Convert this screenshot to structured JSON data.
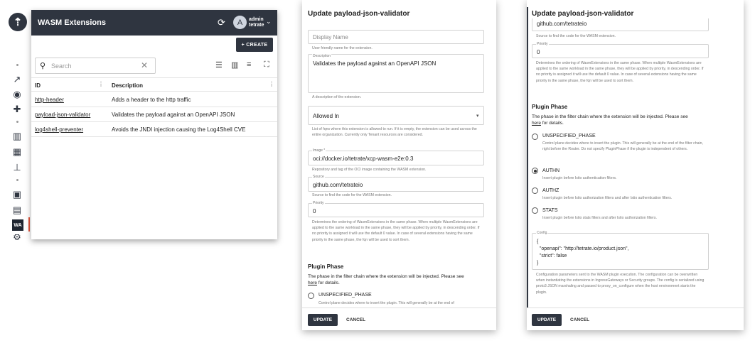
{
  "app": {
    "title": "WASM Extensions",
    "user_line1": "admin",
    "user_line2": "tetrate",
    "avatar_letter": "A",
    "create_label": "+ CREATE"
  },
  "nav": {
    "active_badge": "WA"
  },
  "search": {
    "placeholder": "Search"
  },
  "table": {
    "headers": [
      "ID",
      "Description"
    ],
    "rows": [
      {
        "id": "http-header",
        "description": "Adds a header to the http traffic"
      },
      {
        "id": "payload-json-validator",
        "description": "Validates the payload against an OpenAPI JSON"
      },
      {
        "id": "log4shell-preventer",
        "description": "Avoids the JNDI injection causing the Log4Shell CVE"
      }
    ]
  },
  "form": {
    "title": "Update payload-json-validator",
    "display_name_placeholder": "Display Name",
    "display_name_help": "User friendly name for the extension.",
    "description_label": "Description",
    "description_value": "Validates the payload against an OpenAPI JSON",
    "description_help": "A description of the extension.",
    "allowed_in_label": "Allowed In",
    "allowed_in_help": "List of fqns where this extension is allowed to run. If it is empty, the extension can be used across the entire organization. Currently only Tenant resources are considered.",
    "image_label": "Image *",
    "image_value": "oci://docker.io/tetrate/xcp-wasm-e2e:0.3",
    "image_help": "Repository and tag of the OCI image containing the WASM extension.",
    "source_label": "Source",
    "source_value": "github.com/tetrateio",
    "source_help": "Source to find the code for the WASM extension.",
    "priority_label": "Priority",
    "priority_value": "0",
    "priority_help": "Determines the ordering of WasmExtensions in the same phase. When multiple WasmExtensions are applied to the same workload in the same phase, they will be applied by priority, in descending order. If no priority is assigned it will use the default 0 value. In case of several extensions having the same priority in the same phase, the fqn will be used to sort them.",
    "plugin_phase_title": "Plugin Phase",
    "plugin_phase_desc": "The phase in the filter chain where the extension will be injected. Please see",
    "here_link": "here",
    "for_details": "for details.",
    "phases": [
      {
        "name": "UNSPECIFIED_PHASE",
        "help": "Control plane decides where to insert the plugin. This will generally be at the end of the filter chain, right before the Router. Do not specify PluginPhase if the plugin is independent of others."
      },
      {
        "name": "AUTHN",
        "help": "Insert plugin before Istio authentication filters."
      },
      {
        "name": "AUTHZ",
        "help": "Insert plugin before Istio authorization filters and after Istio authentication filters."
      },
      {
        "name": "STATS",
        "help": "Insert plugin before Istio stats filters and after Istio authorization filters."
      }
    ],
    "selected_phase": "AUTHN",
    "config_label": "Config",
    "config_lines": [
      "{",
      "  \"openapi\": \"http://tetrate.io/product.json\",",
      "  \"strict\": false",
      "}"
    ],
    "config_help": "Configuration parameters sent to the WASM plugin execution. The configuration can be overwritten when instantiating the extensions in IngressGateways or Security groups. The config is serialized using proto3 JSON marshaling and passed to proxy_on_configure when the host environment starts the plugin.",
    "update_label": "UPDATE",
    "cancel_label": "CANCEL",
    "unspecified_help_short": "Control plane decides where to insert the plugin. This will generally be at the end of"
  }
}
